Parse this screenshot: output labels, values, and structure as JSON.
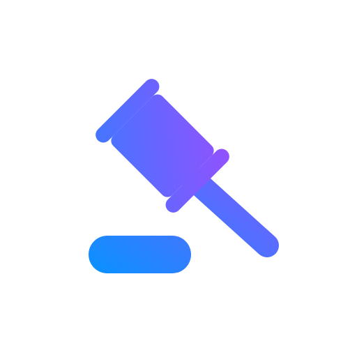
{
  "icon": {
    "name": "gavel-icon",
    "gradient": {
      "start_color": "#0A91FF",
      "end_color": "#9B4DFF"
    },
    "background_color": "#FFFFFF"
  }
}
